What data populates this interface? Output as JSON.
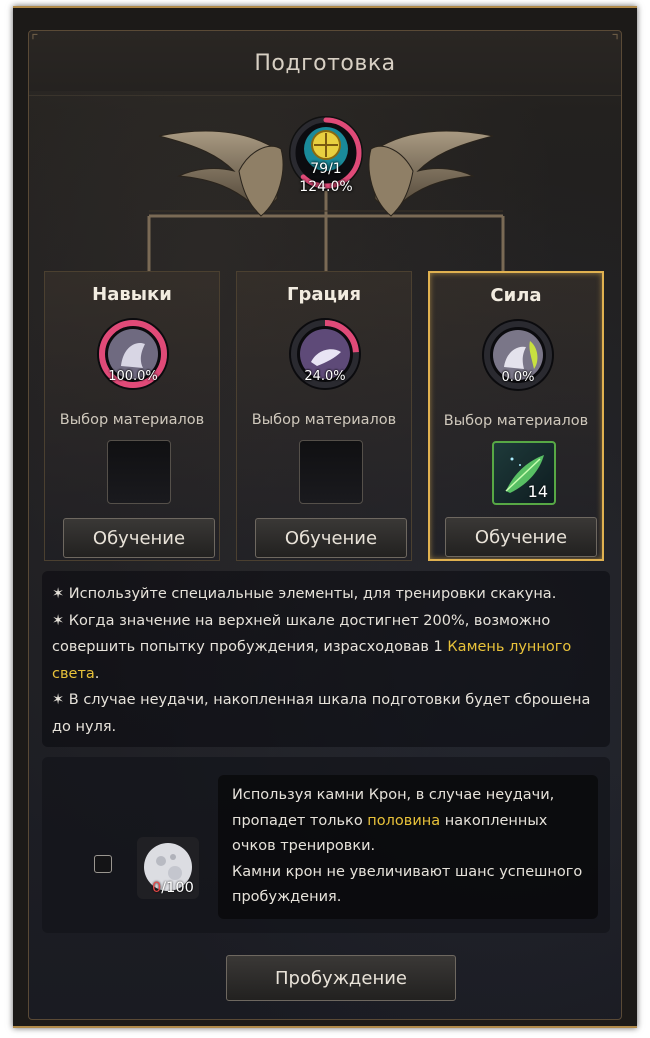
{
  "window": {
    "title": "Подготовка"
  },
  "gauge": {
    "value": "79/1",
    "percent": "124.0%",
    "fill_fraction": 0.62
  },
  "colors": {
    "accent_gold": "#e0b150",
    "highlight_yellow": "#e8c23a",
    "gauge_pink": "#e04a78",
    "count_red": "#e84848"
  },
  "cards": [
    {
      "title": "Навыки",
      "percent": "100.0%",
      "fill_fraction": 1.0,
      "material_label": "Выбор материалов",
      "slot_count": "",
      "button": "Обучение",
      "active": false
    },
    {
      "title": "Грация",
      "percent": "24.0%",
      "fill_fraction": 0.24,
      "material_label": "Выбор материалов",
      "slot_count": "",
      "button": "Обучение",
      "active": false
    },
    {
      "title": "Сила",
      "percent": "0.0%",
      "fill_fraction": 0.0,
      "material_label": "Выбор материалов",
      "slot_count": "14",
      "button": "Обучение",
      "active": true
    }
  ],
  "info": {
    "line1": "✶ Используйте специальные элементы, для тренировки скакуна.",
    "line2_pre": "✶ Когда значение на верхней шкале достигнет 200%, возможно совершить попытку пробуждения, израсходовав 1 ",
    "line2_hl": "Камень лунного света",
    "line2_post": ".",
    "line3": "✶ В случае неудачи, накопленная шкала подготовки будет сброшена до нуля."
  },
  "crown": {
    "count_current": "0",
    "count_total": "/100",
    "text_pre": "Используя камни Крон, в случае неудачи, пропадет только ",
    "text_hl": "половина",
    "text_post": " накопленных очков тренировки.",
    "text_line2": "Камни крон не увеличивают шанс успешного пробуждения."
  },
  "awaken_button": "Пробуждение"
}
